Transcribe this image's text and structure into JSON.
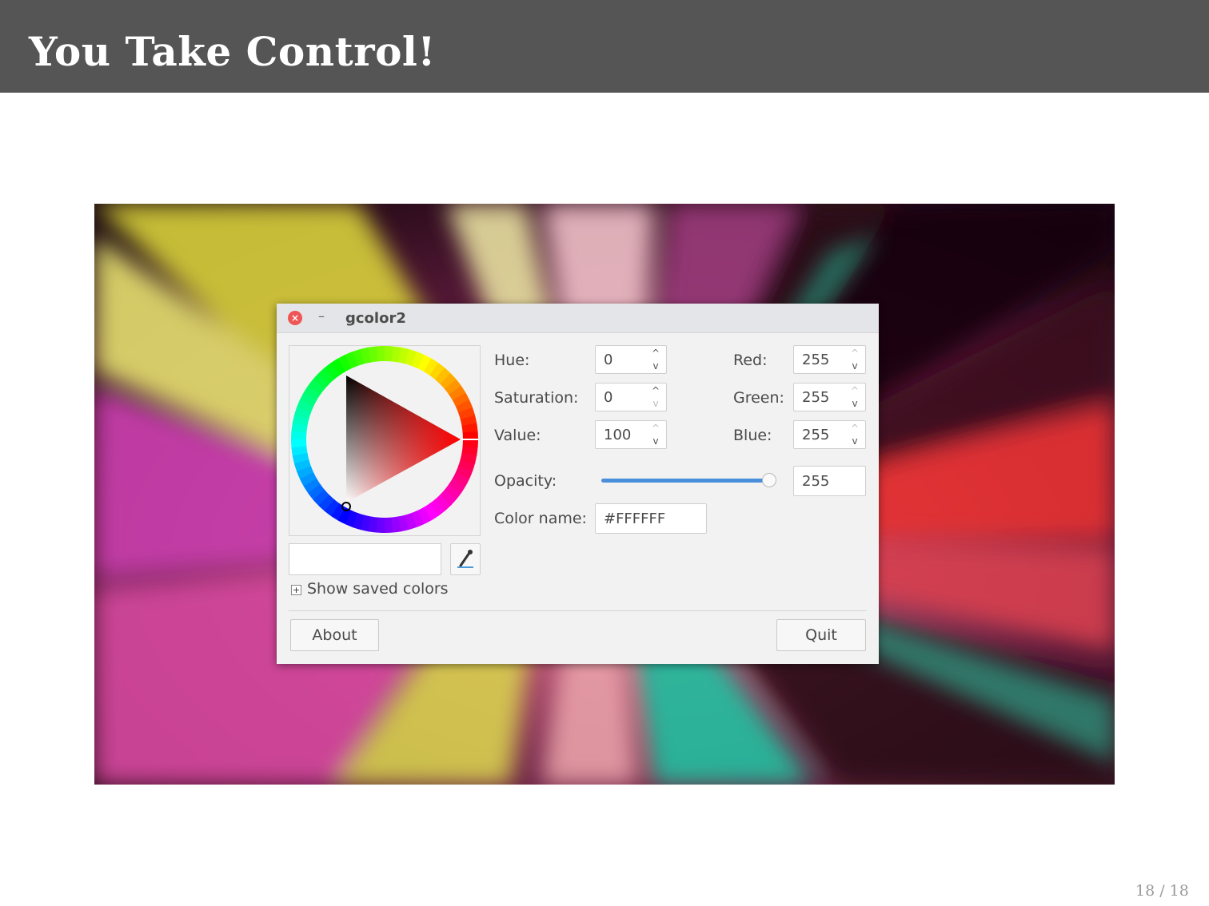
{
  "slide": {
    "title": "You Take Control!",
    "page_number": "18 / 18"
  },
  "window": {
    "title": "gcolor2",
    "close_icon": "close-icon",
    "minimize_icon": "minimize-icon"
  },
  "color_fields": {
    "hue": {
      "label": "Hue:",
      "value": "0"
    },
    "saturation": {
      "label": "Saturation:",
      "value": "0"
    },
    "value": {
      "label": "Value:",
      "value": "100"
    },
    "red": {
      "label": "Red:",
      "value": "255"
    },
    "green": {
      "label": "Green:",
      "value": "255"
    },
    "blue": {
      "label": "Blue:",
      "value": "255"
    }
  },
  "opacity": {
    "label": "Opacity:",
    "value": "255",
    "slider_fraction": 1.0
  },
  "color_name": {
    "label": "Color name:",
    "value": "#FFFFFF"
  },
  "current_color": "#FFFFFF",
  "picker_icon": "eyedropper-icon",
  "saved_colors_toggle": "Show saved colors",
  "buttons": {
    "about": "About",
    "quit": "Quit"
  }
}
